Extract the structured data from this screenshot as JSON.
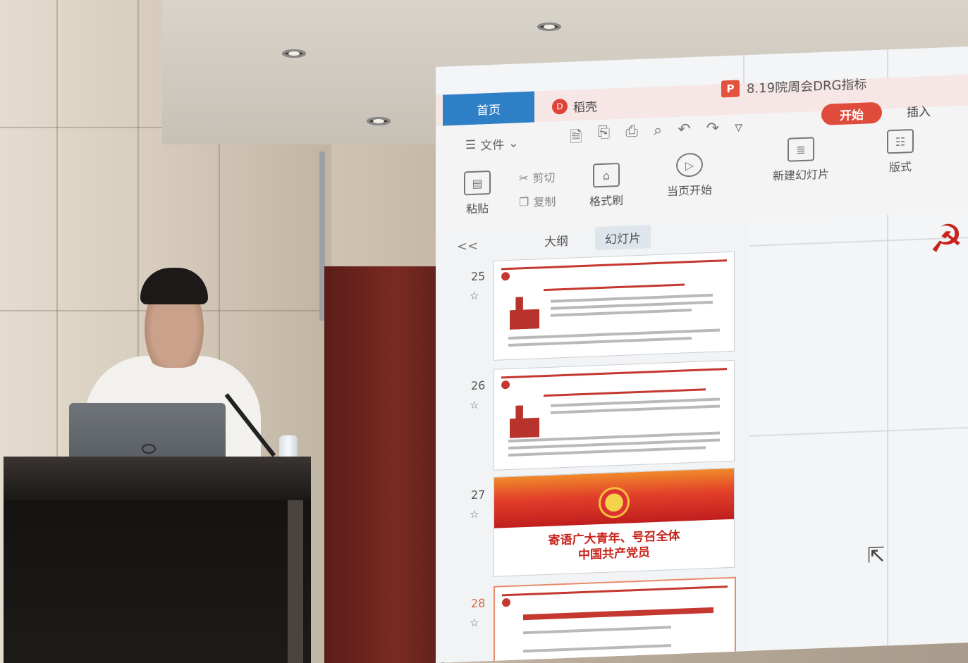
{
  "window": {
    "home_tab": "首页",
    "daoke_tab": "稻壳",
    "daoke_logo": "D",
    "doc_icon": "P",
    "doc_title": "8.19院周会DRG指标"
  },
  "ribbon": {
    "file_menu": "文件",
    "start_tab": "开始",
    "insert_tab": "插入",
    "paste": "粘贴",
    "cut": "剪切",
    "copy": "复制",
    "format_painter": "格式刷",
    "play_from_current": "当页开始",
    "new_slide": "新建幻灯片",
    "layout": "版式"
  },
  "panel": {
    "collapse": "<<",
    "outline_tab": "大纲",
    "slides_tab": "幻灯片"
  },
  "slides": [
    {
      "number": "25"
    },
    {
      "number": "26"
    },
    {
      "number": "27",
      "title_line1": "寄语广大青年、号召全体",
      "title_line2": "中国共产党员"
    },
    {
      "number": "28"
    }
  ],
  "colors": {
    "accent_blue": "#2f7fc6",
    "start_red": "#e04c3c",
    "party_red": "#c8241c"
  }
}
